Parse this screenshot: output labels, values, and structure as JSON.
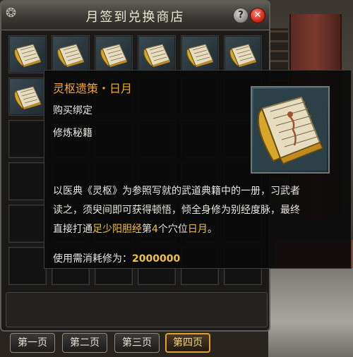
{
  "window": {
    "title": "月签到兑换商店"
  },
  "controls": {
    "help": "?",
    "close": "✕"
  },
  "tabs": [
    {
      "label": "第一页",
      "active": false
    },
    {
      "label": "第二页",
      "active": false
    },
    {
      "label": "第三页",
      "active": false
    },
    {
      "label": "第四页",
      "active": true
    }
  ],
  "tooltip": {
    "name": "灵枢遗策・日月",
    "bind": "购买绑定",
    "type": "修炼秘籍",
    "desc_1": "以医典《灵枢》为参照写就的武道典籍中的一册，习武者",
    "desc_2": "读之，须臾间即可获得顿悟，倾全身修为别经度脉，最终",
    "desc_3_a": "直接打通",
    "desc_3_meridian": "足少阳胆经",
    "desc_3_b": "第",
    "desc_3_num": "4",
    "desc_3_c": "个穴位",
    "desc_3_point": "日月",
    "desc_3_end": "。",
    "cost_label": "使用需消耗修为：",
    "cost_value": "2000000"
  },
  "colors": {
    "item_name": "#f0a830",
    "highlight": "#f2c23a",
    "active_tab_border": "#e0a030"
  },
  "icons": {
    "item": "scroll-book-icon"
  }
}
